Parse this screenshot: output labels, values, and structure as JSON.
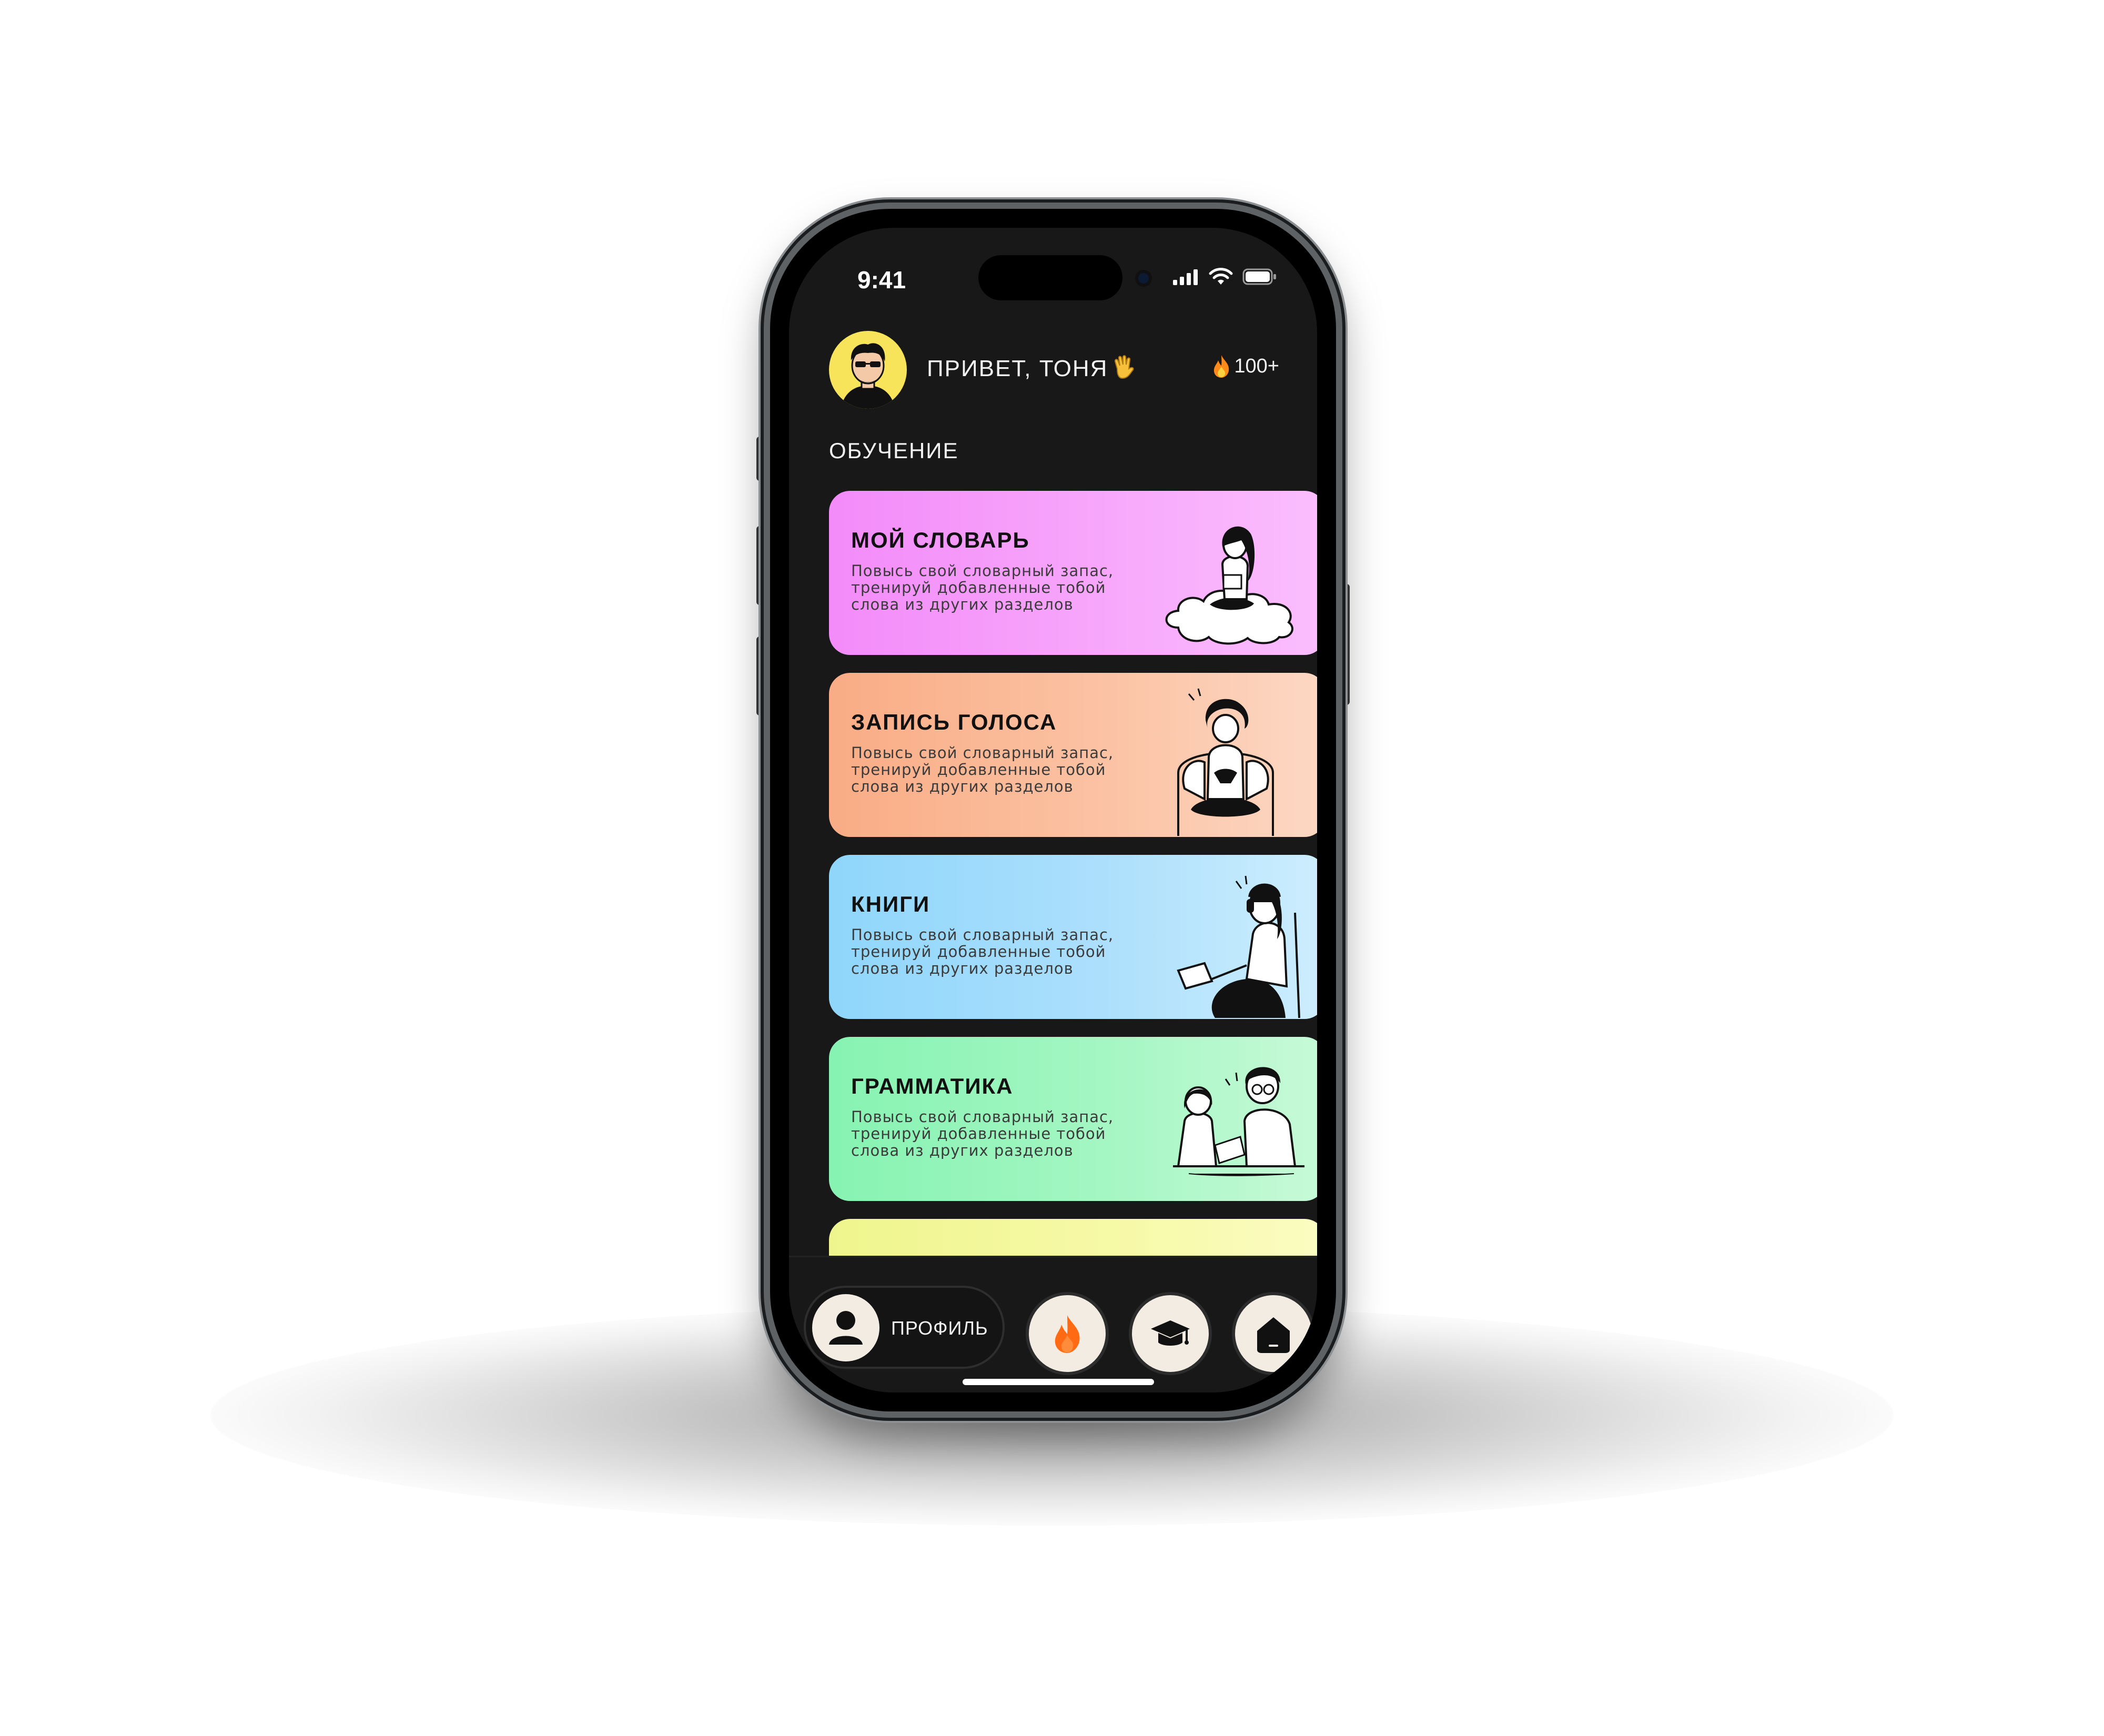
{
  "status_bar": {
    "time": "9:41"
  },
  "header": {
    "greeting": "ПРИВЕТ, ТОНЯ",
    "greeting_icon": "waving-hand-icon",
    "streak_count": "100+"
  },
  "section": {
    "title": "ОБУЧЕНИЕ"
  },
  "cards": [
    {
      "title": "МОЙ СЛОВАРЬ",
      "description": "Повысь свой словарный запас, тренируй добавленные тобой слова из других разделов",
      "color": "#f38bf9"
    },
    {
      "title": "ЗАПИСЬ ГОЛОСА",
      "description": "Повысь свой словарный запас, тренируй добавленные тобой слова из других разделов",
      "color": "#f9ac85"
    },
    {
      "title": "КНИГИ",
      "description": "Повысь свой словарный запас, тренируй добавленные тобой слова из других разделов",
      "color": "#8fd6fb"
    },
    {
      "title": "ГРАММАТИКА",
      "description": "Повысь свой словарный запас, тренируй добавленные тобой слова из других разделов",
      "color": "#86f3b2"
    },
    {
      "title": "",
      "description": "",
      "color": "#eff58d"
    }
  ],
  "bottom_nav": {
    "profile_label": "ПРОФИЛЬ",
    "items": [
      {
        "icon": "user-icon",
        "active": false
      },
      {
        "icon": "fire-icon",
        "active": true
      },
      {
        "icon": "graduation-cap-icon",
        "active": false
      },
      {
        "icon": "home-icon",
        "active": false
      }
    ]
  },
  "colors": {
    "background": "#181818",
    "accent_fire": "#ff6a13",
    "nav_button": "#f2ece3"
  }
}
